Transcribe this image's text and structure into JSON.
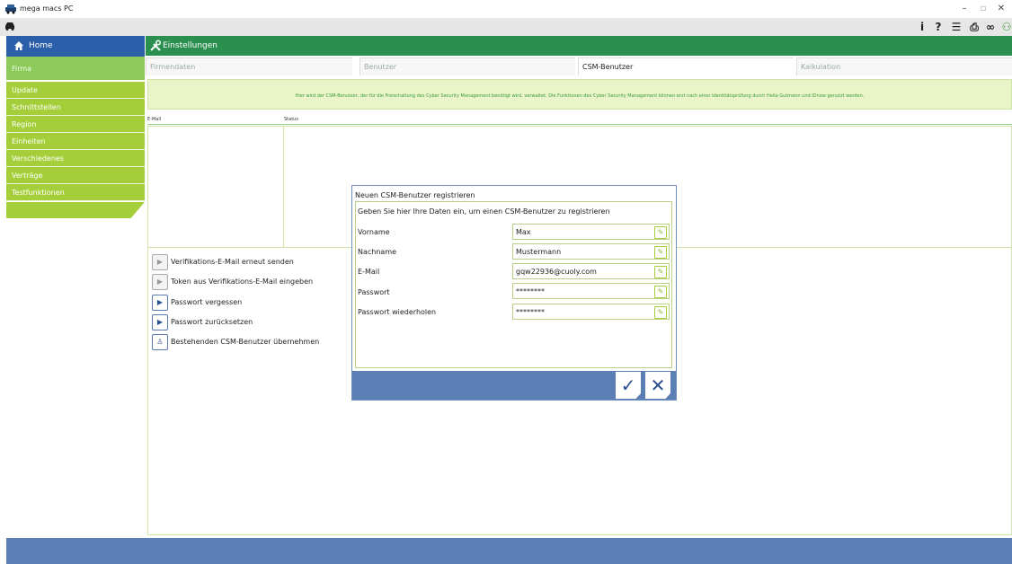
{
  "window": {
    "title": "mega macs PC",
    "min": "–",
    "max": "▫",
    "close": "✕"
  },
  "toolbar": {
    "info_icon": "info-icon",
    "help_icon": "help-icon",
    "list_icon": "list-icon",
    "print_icon": "print-icon",
    "link_icon": "link-icon",
    "network_icon": "network-icon"
  },
  "sidebar": {
    "home": "Home",
    "header": "Firma",
    "items": [
      {
        "label": "Update"
      },
      {
        "label": "Schnittstellen"
      },
      {
        "label": "Region"
      },
      {
        "label": "Einheiten"
      },
      {
        "label": "Verschiedenes"
      },
      {
        "label": "Verträge"
      },
      {
        "label": "Testfunktionen"
      }
    ]
  },
  "header": {
    "title": "Einstellungen"
  },
  "tabs": [
    {
      "label": "Firmendaten",
      "active": false
    },
    {
      "label": "Benutzer",
      "active": false
    },
    {
      "label": "CSM-Benutzer",
      "active": true
    },
    {
      "label": "Kalkulation",
      "active": false
    }
  ],
  "info_text": "Hier wird der CSM-Benutzer, der für die Freischaltung des Cyber Security Management benötigt wird, verwaltet. Die Funktionen des Cyber Security Management können erst nach einer Identitätsprüfung durch Hella Gutmann und IDnow genutzt werden.",
  "table": {
    "columns": [
      "E-Mail",
      "Status"
    ]
  },
  "actions": [
    {
      "label": "Verifikations-E-Mail erneut senden",
      "icon": "play-icon",
      "enabled": false
    },
    {
      "label": "Token aus Verifikations-E-Mail eingeben",
      "icon": "play-icon",
      "enabled": false
    },
    {
      "label": "Passwort vergessen",
      "icon": "play-icon",
      "enabled": true
    },
    {
      "label": "Passwort zurücksetzen",
      "icon": "play-icon",
      "enabled": true
    },
    {
      "label": "Bestehenden CSM-Benutzer übernehmen",
      "icon": "person-icon",
      "enabled": true
    }
  ],
  "dialog": {
    "title": "Neuen CSM-Benutzer registrieren",
    "subtitle": "Geben Sie hier Ihre Daten ein, um einen CSM-Benutzer zu registrieren",
    "fields": [
      {
        "label": "Vorname",
        "value": "Max"
      },
      {
        "label": "Nachname",
        "value": "Mustermann"
      },
      {
        "label": "E-Mail",
        "value": "gqw22936@cuoly.com"
      },
      {
        "label": "Passwort",
        "value": "********"
      },
      {
        "label": "Passwort wiederholen",
        "value": "********"
      }
    ],
    "confirm": "✓",
    "cancel": "✕"
  },
  "colors": {
    "primary_blue": "#5b7fb5",
    "header_green": "#2a8f4f",
    "sidebar_lime": "#a4cf3a",
    "sidebar_header": "#8ec95c"
  }
}
